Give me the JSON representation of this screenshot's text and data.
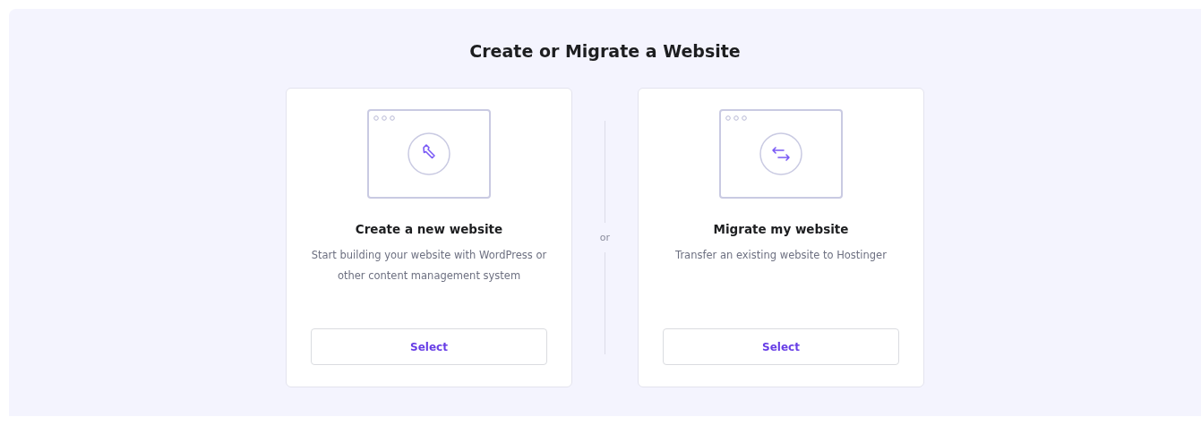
{
  "title": "Create or Migrate a Website",
  "options": [
    {
      "kind": "wrench",
      "title": "Create a new website",
      "description": "Start building your website with WordPress or other content management system",
      "button": "Select"
    },
    {
      "kind": "arrows",
      "title": "Migrate my website",
      "description": "Transfer an existing website to Hostinger",
      "button": "Select"
    }
  ],
  "separator": "or"
}
